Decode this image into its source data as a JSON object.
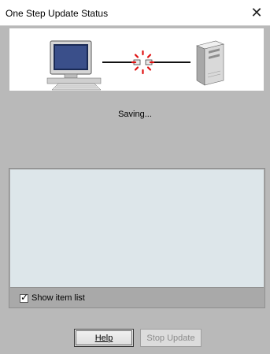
{
  "window": {
    "title": "One Step Update Status",
    "close_label": "✕"
  },
  "status": {
    "message": "Saving..."
  },
  "item_list": {
    "items": []
  },
  "options": {
    "show_item_list_label": "Show item list",
    "show_item_list_checked": true,
    "check_glyph": "✓"
  },
  "buttons": {
    "help_label": "Help",
    "stop_update_label": "Stop Update",
    "stop_update_enabled": false
  },
  "icons": {
    "computer": "desktop-computer-icon",
    "connection": "network-connection-icon",
    "server": "server-tower-icon"
  }
}
